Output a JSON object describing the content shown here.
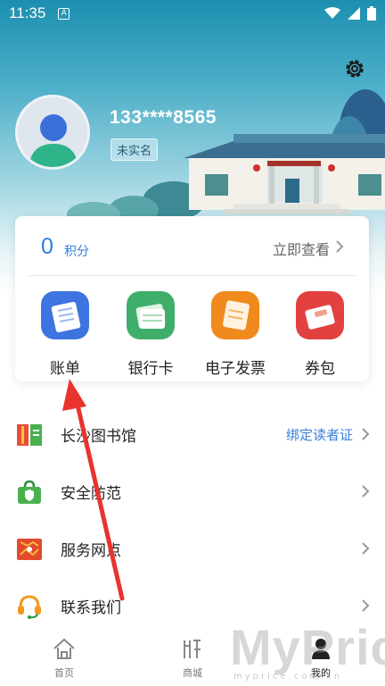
{
  "status_bar": {
    "time": "11:35",
    "notification_letter": "A"
  },
  "profile": {
    "phone": "133****8565",
    "verify_badge": "未实名"
  },
  "points": {
    "value": "0",
    "label": "积分",
    "view_link": "立即查看"
  },
  "quick_actions": [
    {
      "label": "账单",
      "icon": "bill-icon",
      "color": "#3d74e0"
    },
    {
      "label": "银行卡",
      "icon": "bank-card-icon",
      "color": "#3fae6b"
    },
    {
      "label": "电子发票",
      "icon": "e-invoice-icon",
      "color": "#f08a1c"
    },
    {
      "label": "券包",
      "icon": "coupon-icon",
      "color": "#e2423f"
    }
  ],
  "menu": [
    {
      "label": "长沙图书馆",
      "extra": "绑定读者证",
      "icon": "library-icon"
    },
    {
      "label": "安全防范",
      "extra": "",
      "icon": "shield-bag-icon"
    },
    {
      "label": "服务网点",
      "extra": "",
      "icon": "map-icon"
    },
    {
      "label": "联系我们",
      "extra": "",
      "icon": "headset-icon"
    }
  ],
  "tabs": [
    {
      "label": "首页",
      "icon": "home-icon"
    },
    {
      "label": "商城",
      "icon": "mall-icon"
    },
    {
      "label": "我的",
      "icon": "profile-icon"
    }
  ],
  "watermark": {
    "text": "MyPrice",
    "sub": "myprice.com.cn"
  },
  "colors": {
    "accent": "#2f7de1",
    "link": "#3b7fd8",
    "annotation_arrow": "#e8332e"
  }
}
